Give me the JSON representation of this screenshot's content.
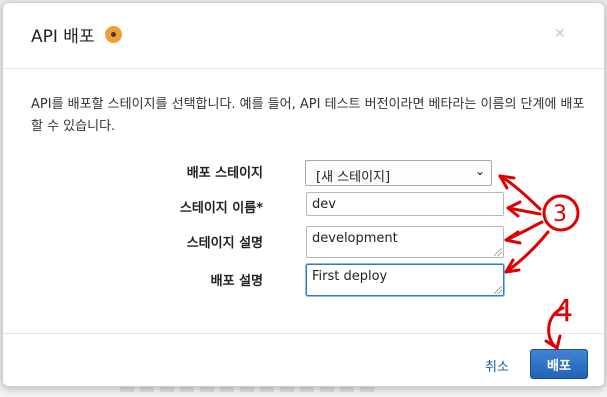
{
  "dialog": {
    "title": "API 배포",
    "close_icon": "close-icon",
    "description": "API를 배포할 스테이지를 선택합니다. 예를 들어, API 테스트 버전이라면 베타라는 이름의 단계에 배포할 수 있습니다."
  },
  "form": {
    "deploy_stage_label": "배포 스테이지",
    "deploy_stage_value": "[새 스테이지]",
    "stage_name_label": "스테이지 이름*",
    "stage_name_value": "dev",
    "stage_desc_label": "스테이지 설명",
    "stage_desc_value": "development",
    "deploy_desc_label": "배포 설명",
    "deploy_desc_value": "First deploy"
  },
  "footer": {
    "cancel_label": "취소",
    "deploy_label": "배포"
  },
  "annotations": {
    "number_3": "3",
    "number_4": "4",
    "color": "#e00000"
  },
  "colors": {
    "primary_button": "#2f72c6",
    "info_dot": "#f0a030",
    "focus_border": "#2b7bd0"
  }
}
